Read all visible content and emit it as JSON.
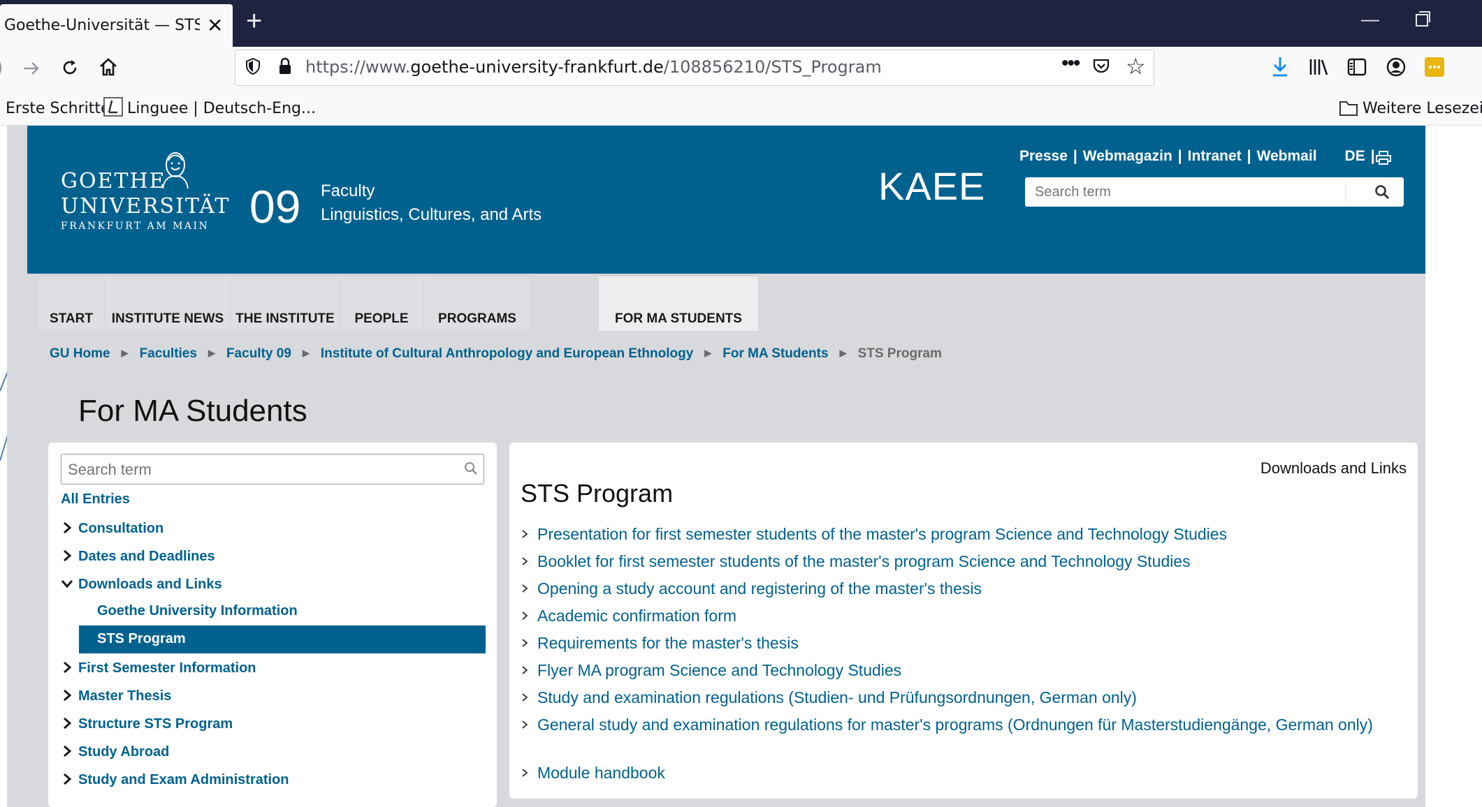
{
  "browser": {
    "tab_title": "Goethe-Universität — STS Program",
    "url_prefix": "https://www.",
    "url_domain": "goethe-university-frankfurt.de",
    "url_path": "/108856210/STS_Program",
    "bookmarks": [
      "Erste Schritte",
      "Linguee | Deutsch-Eng...",
      "Weitere Lesezeichen"
    ]
  },
  "header": {
    "logo_line1": "GOETHE",
    "logo_line2": "UNIVERSITÄT",
    "logo_line3": "FRANKFURT AM MAIN",
    "faculty_number": "09",
    "faculty_label": "Faculty",
    "faculty_name": "Linguistics, Cultures, and Arts",
    "institute_abbr": "KAEE",
    "top_links": [
      "Presse",
      "Webmagazin",
      "Intranet",
      "Webmail"
    ],
    "lang": "DE",
    "search_placeholder": "Search term"
  },
  "main_nav": [
    "START",
    "INSTITUTE NEWS",
    "THE INSTITUTE",
    "PEOPLE",
    "PROGRAMS",
    "FOR MA STUDENTS"
  ],
  "breadcrumb": {
    "links": [
      "GU Home",
      "Faculties",
      "Faculty 09",
      "Institute of Cultural Anthropology and European Ethnology",
      "For MA Students"
    ],
    "current": "STS Program"
  },
  "page_title": "For MA Students",
  "sidebar": {
    "search_placeholder": "Search term",
    "all_entries": "All Entries",
    "items": [
      "Consultation",
      "Dates and Deadlines",
      "Downloads and Links"
    ],
    "subitems": [
      "Goethe University Information",
      "STS Program"
    ],
    "items_after": [
      "First Semester Information",
      "Master Thesis",
      "Structure STS Program",
      "Study Abroad",
      "Study and Exam Administration"
    ]
  },
  "content": {
    "section_link": "Downloads and Links",
    "title": "STS Program",
    "links": [
      "Presentation for first semester students of the master's program Science and Technology Studies",
      "Booklet for first semester students of the master's program Science and Technology Studies",
      "Opening a study account and registering of the master's thesis",
      "Academic confirmation form",
      "Requirements for the master's thesis",
      "Flyer MA program Science and Technology Studies",
      "Study and examination regulations (Studien- und Prüfungsordnungen, German only)",
      "General study and examination regulations for master's programs (Ordnungen für Masterstudiengänge, German only)",
      "Module handbook"
    ]
  },
  "colors": {
    "brand_blue": "#00618f",
    "page_bg": "#d7d9dc",
    "tabbar": "#202340"
  }
}
